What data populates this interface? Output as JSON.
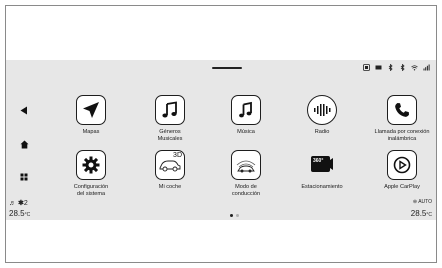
{
  "status_icons": [
    "screen-mirror-icon",
    "battery-icon",
    "bluetooth-icon",
    "bluetooth-alt-icon",
    "wifi-icon",
    "signal-icon"
  ],
  "left_nav": [
    "back-icon",
    "home-icon",
    "apps-grid-icon"
  ],
  "fan_level": "2",
  "left_temp": "28.5",
  "right_temp": "28.5",
  "temp_unit": "°C",
  "right_mode": "AUTO",
  "apps": [
    {
      "label": "Mapas",
      "icon": "navigation-arrow-icon"
    },
    {
      "label": "Géneros\nMusicales",
      "icon": "music-notes-icon"
    },
    {
      "label": "Música",
      "icon": "music-note-icon"
    },
    {
      "label": "Radio",
      "icon": "radio-waves-icon"
    },
    {
      "label": "Llamada por conexión\ninalámbrica",
      "icon": "phone-icon"
    },
    {
      "label": "Configuración\ndel sistema",
      "icon": "settings-gear-icon"
    },
    {
      "label": "Mi coche",
      "icon": "car-3d-icon"
    },
    {
      "label": "Modo de\nconducción",
      "icon": "drive-mode-icon"
    },
    {
      "label": "Estacionamiento",
      "icon": "parking-360-icon"
    },
    {
      "label": "Apple CarPlay",
      "icon": "carplay-icon"
    }
  ],
  "badge_3d": "3D",
  "badge_360": "360°",
  "page_index": 1,
  "page_count": 2
}
